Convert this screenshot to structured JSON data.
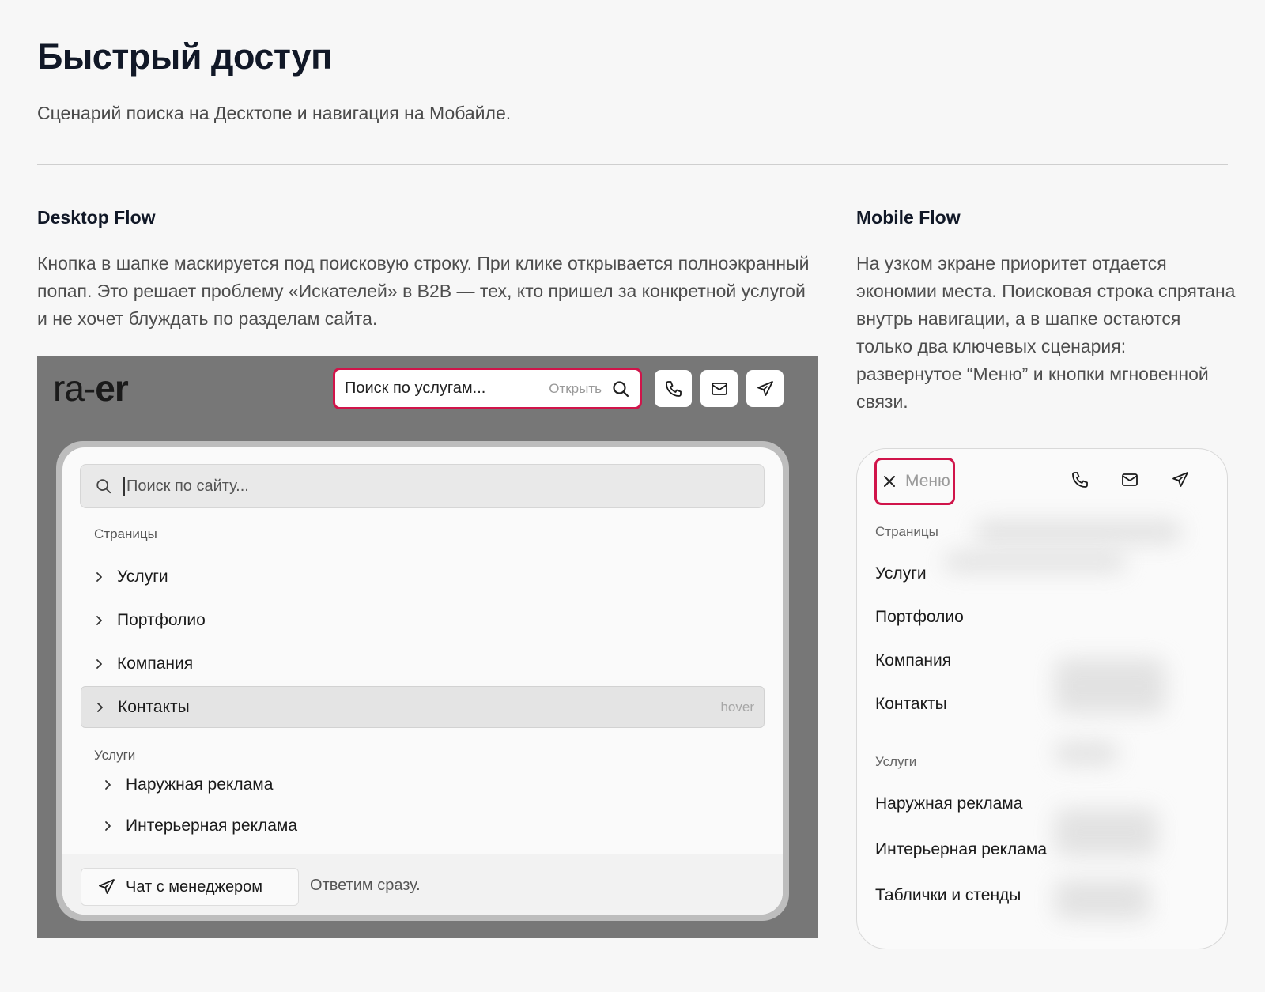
{
  "page": {
    "title": "Быстрый доступ",
    "subtitle": "Сценарий поиска на Десктопе и навигация на Мобайле."
  },
  "desktop": {
    "heading": "Desktop Flow",
    "description": "Кнопка в шапке маскируется под поисковую строку. При клике открывается полноэкранный попап. Это решает проблему «Искателей» в B2B — тех, кто пришел за конкретной услугой и не хочет блуждать по разделам сайта.",
    "header": {
      "logo_light": "ra-",
      "logo_bold": "er",
      "search_button_label": "Поиск по услугам...",
      "search_button_hint": "Открыть",
      "icons": [
        "phone-icon",
        "mail-icon",
        "telegram-icon"
      ]
    },
    "popup": {
      "search_placeholder": "Поиск по сайту...",
      "pages_group_label": "Страницы",
      "pages": [
        "Услуги",
        "Портфолио",
        "Компания",
        "Контакты"
      ],
      "hover_hint": "hover",
      "services_group_label": "Услуги",
      "services": [
        "Наружная реклама",
        "Интерьерная реклама"
      ],
      "chat_button_label": "Чат с менеджером",
      "chat_note": "Ответим сразу."
    }
  },
  "mobile": {
    "heading": "Mobile Flow",
    "description": "На узком экране приоритет отдается экономии места. Поисковая строка спрятана внутрь навигации, а в шапке остаются только два ключевых сценария: развернутое “Меню” и кнопки мгновенной связи.",
    "menu_button_label": "Меню",
    "pages_group_label": "Страницы",
    "pages": [
      "Услуги",
      "Портфолио",
      "Компания",
      "Контакты"
    ],
    "services_group_label": "Услуги",
    "services": [
      "Наружная реклама",
      "Интерьерная реклама",
      "Таблички и стенды"
    ]
  },
  "colors": {
    "accent": "#d0144a",
    "background": "#f7f7f7",
    "desktop_overlay": "#777777"
  }
}
